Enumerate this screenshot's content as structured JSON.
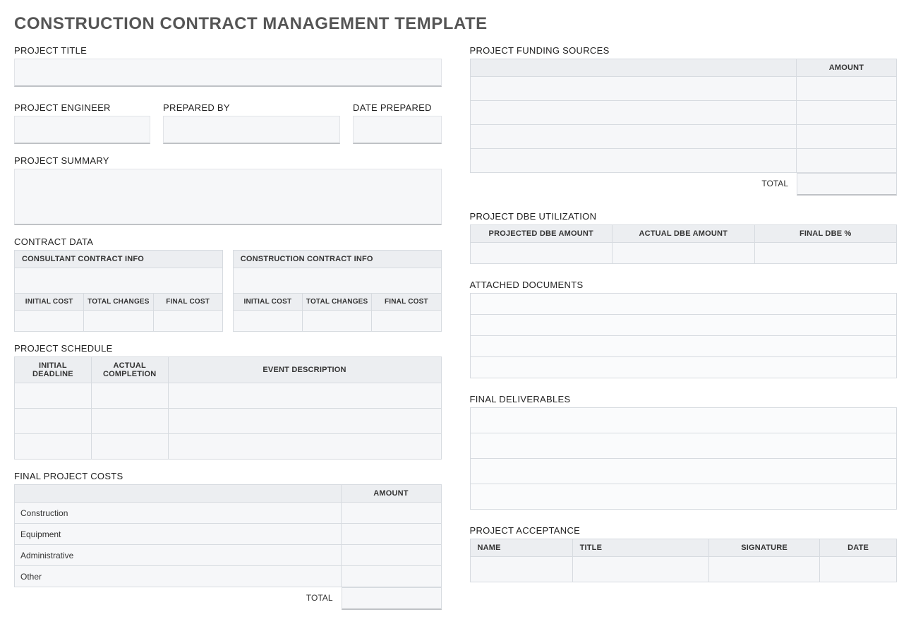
{
  "title": "CONSTRUCTION CONTRACT MANAGEMENT TEMPLATE",
  "left": {
    "project_title_lbl": "PROJECT TITLE",
    "engineer_lbl": "PROJECT ENGINEER",
    "prepared_lbl": "PREPARED BY",
    "date_lbl": "DATE PREPARED",
    "summary_lbl": "PROJECT SUMMARY",
    "contract_data_lbl": "CONTRACT DATA",
    "consultant_hdr": "CONSULTANT CONTRACT INFO",
    "construction_hdr": "CONSTRUCTION CONTRACT INFO",
    "initial_cost": "INITIAL COST",
    "total_changes": "TOTAL CHANGES",
    "final_cost": "FINAL COST",
    "schedule_lbl": "PROJECT SCHEDULE",
    "sched_initial": "INITIAL DEADLINE",
    "sched_actual": "ACTUAL COMPLETION",
    "sched_event": "EVENT DESCRIPTION",
    "final_costs_lbl": "FINAL PROJECT COSTS",
    "amount": "AMOUNT",
    "costs": [
      "Construction",
      "Equipment",
      "Administrative",
      "Other"
    ],
    "total": "TOTAL"
  },
  "right": {
    "funding_lbl": "PROJECT FUNDING SOURCES",
    "amount": "AMOUNT",
    "total": "TOTAL",
    "dbe_lbl": "PROJECT DBE UTILIZATION",
    "dbe_proj": "PROJECTED DBE AMOUNT",
    "dbe_actual": "ACTUAL DBE AMOUNT",
    "dbe_pct": "FINAL DBE %",
    "docs_lbl": "ATTACHED DOCUMENTS",
    "deliv_lbl": "FINAL DELIVERABLES",
    "accept_lbl": "PROJECT ACCEPTANCE",
    "acc_name": "NAME",
    "acc_title": "TITLE",
    "acc_sig": "SIGNATURE",
    "acc_date": "DATE"
  }
}
